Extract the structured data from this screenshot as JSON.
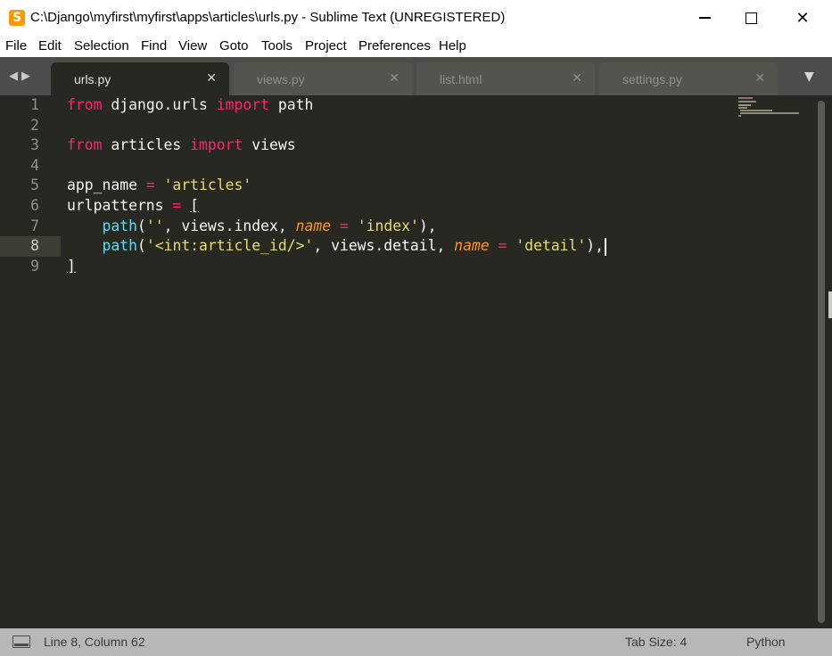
{
  "window": {
    "title": "C:\\Django\\myfirst\\myfirst\\apps\\articles\\urls.py - Sublime Text (UNREGISTERED)",
    "app_icon_glyph": "S",
    "minimize": "—",
    "close": "✕"
  },
  "menu": [
    "File",
    "Edit",
    "Selection",
    "Find",
    "View",
    "Goto",
    "Tools",
    "Project",
    "Preferences",
    "Help"
  ],
  "tabs": [
    {
      "label": "urls.py",
      "active": true
    },
    {
      "label": "views.py",
      "active": false
    },
    {
      "label": "list.html",
      "active": false
    },
    {
      "label": "settings.py",
      "active": false
    }
  ],
  "tab_close_glyph": "✕",
  "nav_arrows": "◀▶",
  "tab_menu_glyph": "▼",
  "editor": {
    "line_numbers": [
      "1",
      "2",
      "3",
      "4",
      "5",
      "6",
      "7",
      "8",
      "9"
    ],
    "current_line": 8
  },
  "status": {
    "position": "Line 8, Column 62",
    "tab_size": "Tab Size: 4",
    "syntax": "Python"
  },
  "colors": {
    "background": "#272822",
    "keyword": "#f92672",
    "string": "#e6db74",
    "function": "#66d9ef",
    "argument": "#fd971f",
    "text": "#f8f8f2"
  }
}
